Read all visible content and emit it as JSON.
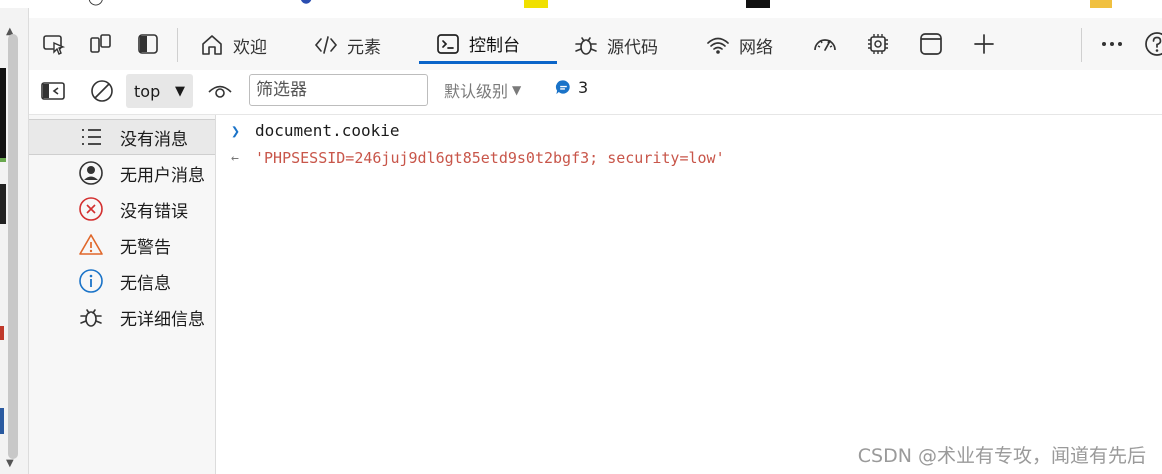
{
  "tabs": {
    "welcome": "欢迎",
    "elements": "元素",
    "console": "控制台",
    "sources": "源代码",
    "network": "网络"
  },
  "toolbar": {
    "context": "top",
    "filter_placeholder": "筛选器",
    "levels": "默认级别",
    "issues_count": "3"
  },
  "sidebar": {
    "items": [
      {
        "label": "没有消息",
        "icon": "list-icon"
      },
      {
        "label": "无用户消息",
        "icon": "user-icon"
      },
      {
        "label": "没有错误",
        "icon": "error-icon"
      },
      {
        "label": "无警告",
        "icon": "warning-icon"
      },
      {
        "label": "无信息",
        "icon": "info-icon"
      },
      {
        "label": "无详细信息",
        "icon": "bug-icon"
      }
    ]
  },
  "console": {
    "input": "document.cookie",
    "output": "'PHPSESSID=246juj9dl6gt85etd9s0t2bgf3; security=low'"
  },
  "watermark": "CSDN @术业有专攻，闻道有先后",
  "colors": {
    "accent": "#0a64c8",
    "error": "#d32f2f",
    "warning": "#e0672a",
    "info": "#1a73c8",
    "string": "#c8564a"
  }
}
